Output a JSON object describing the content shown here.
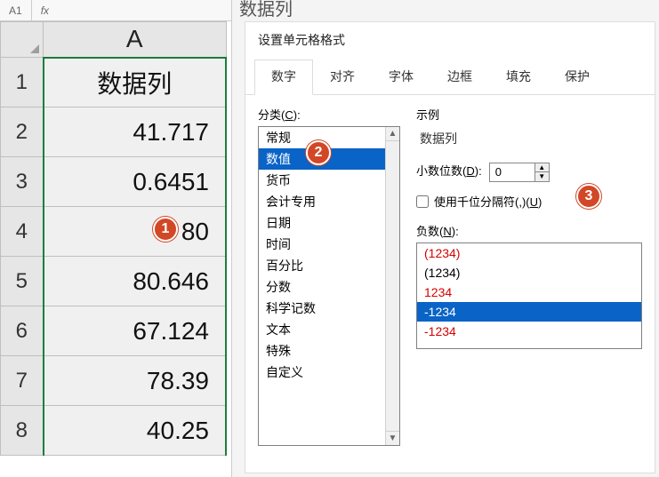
{
  "formula_bar": {
    "cell_ref": "A1",
    "fx": "fx"
  },
  "dialog_outer_title": "数据列",
  "sheet": {
    "column_label": "A",
    "rows": [
      {
        "num": "1",
        "value": "数据列"
      },
      {
        "num": "2",
        "value": "41.717"
      },
      {
        "num": "3",
        "value": "0.6451"
      },
      {
        "num": "4",
        "value": "80"
      },
      {
        "num": "5",
        "value": "80.646"
      },
      {
        "num": "6",
        "value": "67.124"
      },
      {
        "num": "7",
        "value": "78.39"
      },
      {
        "num": "8",
        "value": "40.25"
      }
    ]
  },
  "dialog": {
    "caption": "设置单元格格式",
    "tabs": [
      "数字",
      "对齐",
      "字体",
      "边框",
      "填充",
      "保护"
    ],
    "active_tab": 0,
    "category_label_prefix": "分类(",
    "category_label_key": "C",
    "category_label_suffix": "):",
    "categories": [
      "常规",
      "数值",
      "货币",
      "会计专用",
      "日期",
      "时间",
      "百分比",
      "分数",
      "科学记数",
      "文本",
      "特殊",
      "自定义"
    ],
    "selected_category": 1,
    "sample_label": "示例",
    "sample_value": "数据列",
    "decimal_label_prefix": "小数位数(",
    "decimal_label_key": "D",
    "decimal_label_suffix": "):",
    "decimal_value": "0",
    "thousands_prefix": "使用千位分隔符(,)(",
    "thousands_key": "U",
    "thousands_suffix": ")",
    "thousands_checked": false,
    "neg_label_prefix": "负数(",
    "neg_label_key": "N",
    "neg_label_suffix": "):",
    "neg_options": [
      {
        "text": "(1234)",
        "red": true
      },
      {
        "text": "(1234)",
        "red": false
      },
      {
        "text": "1234",
        "red": true
      },
      {
        "text": "-1234",
        "red": false
      },
      {
        "text": "-1234",
        "red": true
      }
    ],
    "selected_neg": 3
  },
  "callouts": {
    "c1": "1",
    "c2": "2",
    "c3": "3"
  }
}
